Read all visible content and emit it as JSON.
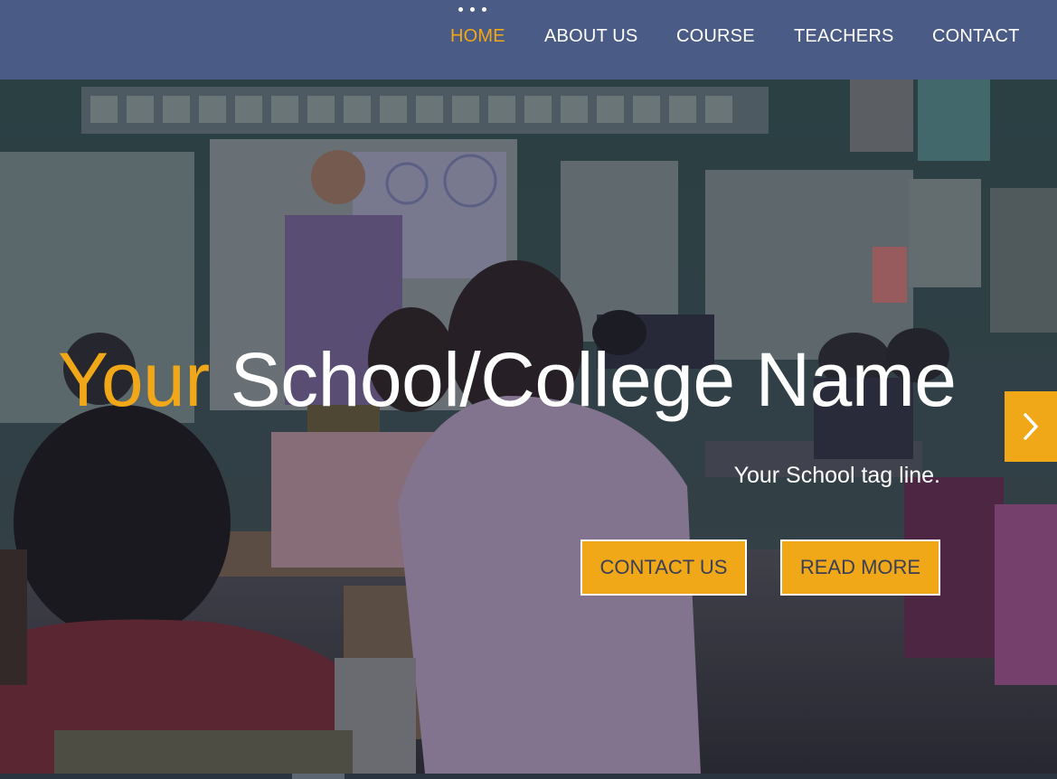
{
  "nav": {
    "items": [
      {
        "label": "HOME",
        "active": true
      },
      {
        "label": "ABOUT US",
        "active": false
      },
      {
        "label": "COURSE",
        "active": false
      },
      {
        "label": "TEACHERS",
        "active": false
      },
      {
        "label": "CONTACT",
        "active": false
      }
    ],
    "menu_icon": "three-dots-icon"
  },
  "hero": {
    "title_accent": "Your",
    "title_rest": "School/College Name",
    "tagline": "Your School tag line.",
    "contact_button": "CONTACT US",
    "read_more_button": "READ MORE",
    "next_icon": "chevron-right-icon",
    "background_image": "classroom-photo"
  },
  "colors": {
    "navbar": "#4a5b85",
    "accent": "#f0a818",
    "text": "#ffffff"
  }
}
